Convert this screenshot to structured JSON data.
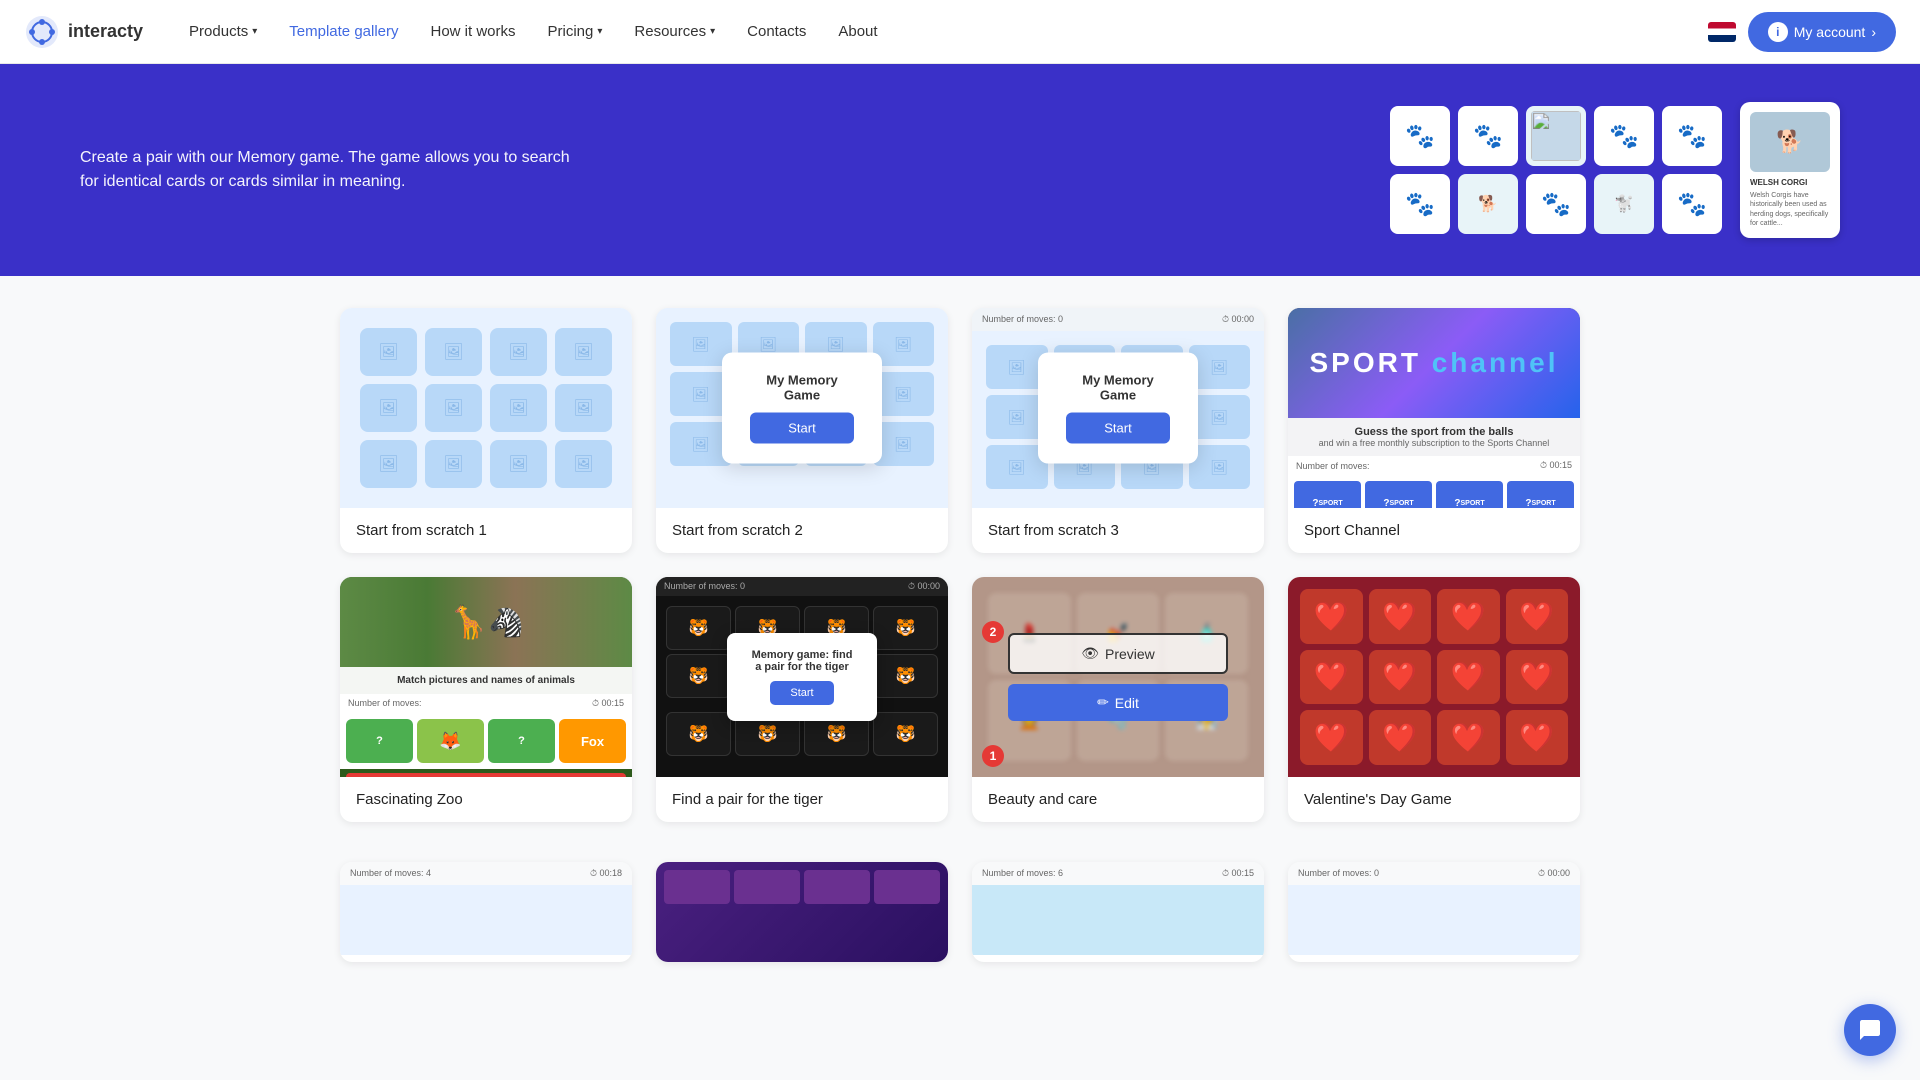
{
  "navbar": {
    "logo_text": "interacty",
    "nav_items": [
      {
        "label": "Products",
        "has_dropdown": true,
        "active": false
      },
      {
        "label": "Template gallery",
        "has_dropdown": false,
        "active": true
      },
      {
        "label": "How it works",
        "has_dropdown": false,
        "active": false
      },
      {
        "label": "Pricing",
        "has_dropdown": true,
        "active": false
      },
      {
        "label": "Resources",
        "has_dropdown": true,
        "active": false
      },
      {
        "label": "Contacts",
        "has_dropdown": false,
        "active": false
      },
      {
        "label": "About",
        "has_dropdown": false,
        "active": false
      }
    ],
    "my_account_label": "My account",
    "info_icon": "ℹ",
    "chevron": "›"
  },
  "hero": {
    "description": "Create a pair with our Memory game. The game allows you to search for identical cards or cards similar in meaning."
  },
  "templates": {
    "cards": [
      {
        "id": "scratch1",
        "label": "Start from scratch 1",
        "type": "scratch1"
      },
      {
        "id": "scratch2",
        "label": "Start from scratch 2",
        "type": "scratch2"
      },
      {
        "id": "scratch3",
        "label": "Start from scratch 3",
        "type": "scratch3"
      },
      {
        "id": "sport",
        "label": "Sport Channel",
        "type": "sport"
      },
      {
        "id": "zoo",
        "label": "Fascinating Zoo",
        "type": "zoo"
      },
      {
        "id": "tiger",
        "label": "Find a pair for the tiger",
        "type": "tiger"
      },
      {
        "id": "beauty",
        "label": "Beauty and care",
        "type": "beauty"
      },
      {
        "id": "valentine",
        "label": "Valentine's Day Game",
        "type": "valentine"
      }
    ],
    "modal": {
      "game_title": "My Memory Game",
      "start_btn": "Start",
      "tiger_game_title": "Memory game: find a pair for the tiger",
      "tiger_start_btn": "Start"
    },
    "sport": {
      "channel_label": "SPORT",
      "channel_word": "channel",
      "subtitle": "Guess the sport from the balls",
      "subtitle2": "and win a free monthly subscription to the Sports Channel",
      "moves_label": "Number of moves:",
      "time_label": "00:15"
    },
    "zoo": {
      "title": "Match pictures and names of animals",
      "fox_label": "Fox",
      "moves_label": "Number of moves:",
      "time_val": "00:15"
    },
    "tiger": {
      "moves_label": "Number of moves:",
      "moves_val": "0",
      "time_val": "00:00"
    },
    "beauty": {
      "preview_btn": "Preview",
      "edit_btn": "Edit",
      "badge1": "1",
      "badge2": "2"
    }
  },
  "chat": {
    "icon": "💬"
  }
}
